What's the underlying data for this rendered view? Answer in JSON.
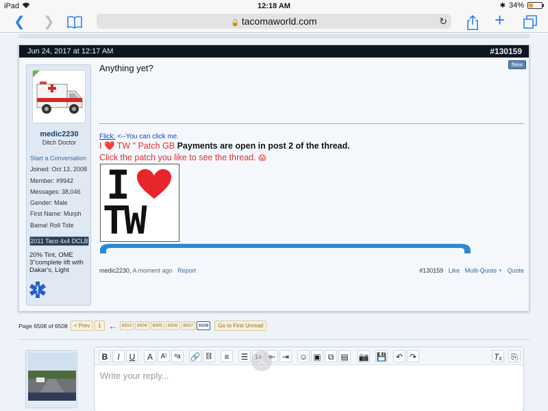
{
  "status_bar": {
    "device": "iPad",
    "time": "12:18 AM",
    "battery": "34%",
    "battery_level": 0.34
  },
  "browser": {
    "url": "tacomaworld.com"
  },
  "post": {
    "date": "Jun 24, 2017 at 12:17 AM",
    "number": "#130159",
    "new_label": "New",
    "message": "Anything yet?",
    "user": {
      "name": "medic2230",
      "title": "Ditch Doctor",
      "start_conversation": "Start a Conversation",
      "joined": "Joined: Oct 13, 2008",
      "member": "Member: #9942",
      "messages": "Messages: 38,046",
      "gender": "Gender: Male",
      "first_name": "First Name: Murph",
      "motto": "Bama! Roll Tide",
      "truck": "2011 Taco 4x4 DCLB",
      "mods": "20% Tint, OME 3\"complete lift with Dakar's, Light"
    },
    "signature": {
      "flick_link": "Flick:",
      "flick_text": " <--You can click me.",
      "line2_pre": "I ",
      "line2_mid": " TW \" Patch GB ",
      "line2_bold": "Payments are open in post 2 of the thread.",
      "line3": "Click the patch you like to see the thread.",
      "logo_top": "I",
      "logo_bottom": "TW"
    },
    "footer": {
      "author": "medic2230,",
      "time": "A moment ago",
      "report": "Report",
      "number": "#130159",
      "like": "Like",
      "multi_quote": "Multi-Quote +",
      "quote": "Quote"
    }
  },
  "pagination": {
    "label": "Page 6508 of 6508",
    "prev": "< Prev",
    "first": "1",
    "arrow": "←",
    "pages": [
      "6503",
      "6504",
      "6505",
      "6506",
      "6507"
    ],
    "current": "6508",
    "go_unread": "Go to First Unread"
  },
  "reply": {
    "placeholder": "Write your reply..."
  },
  "colors": {
    "header_bg": "#0e1622",
    "link": "#3a6ca0",
    "accent_red": "#e03232",
    "blue_arc": "#2a8ad0"
  }
}
